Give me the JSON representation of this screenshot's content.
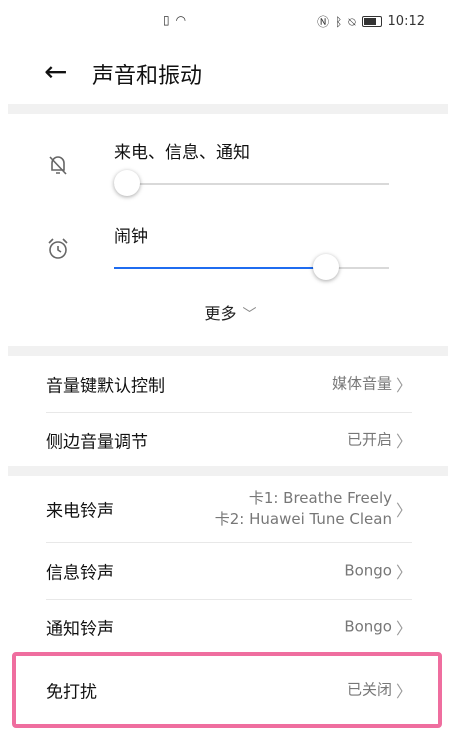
{
  "status_bar": {
    "time": "10:12",
    "center_icons": [
      "sim-icon",
      "wifi-icon"
    ],
    "right_icons": [
      "nfc-icon",
      "bluetooth-icon",
      "mute-icon",
      "battery-icon"
    ]
  },
  "header": {
    "title": "声音和振动"
  },
  "volume": {
    "ringtone_label": "来电、信息、通知",
    "ringtone_level": 0,
    "alarm_label": "闹钟",
    "alarm_level": 0.8,
    "accent_color": "#1f6cf0",
    "more_label": "更多"
  },
  "settings_group1": [
    {
      "label": "音量键默认控制",
      "value": "媒体音量"
    },
    {
      "label": "侧边音量调节",
      "value": "已开启"
    }
  ],
  "settings_group2": [
    {
      "label": "来电铃声",
      "value_line1": "卡1: Breathe Freely",
      "value_line2": "卡2: Huawei Tune Clean"
    },
    {
      "label": "信息铃声",
      "value": "Bongo"
    },
    {
      "label": "通知铃声",
      "value": "Bongo"
    }
  ],
  "settings_group3": [
    {
      "label": "免打扰",
      "value": "已关闭"
    }
  ],
  "highlight_color": "#ef6e9f"
}
